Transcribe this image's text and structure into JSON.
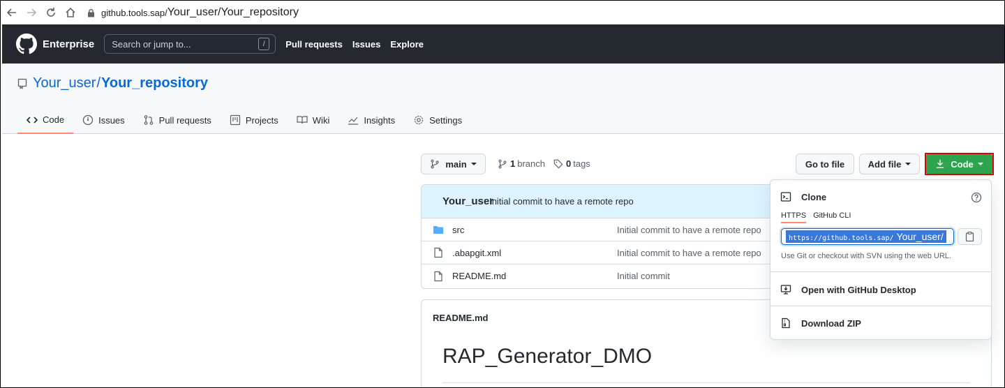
{
  "browser": {
    "url_host": "github.tools.sap/",
    "url_path": "Your_user/Your_repository"
  },
  "header": {
    "brand": "Enterprise",
    "search_placeholder": "Search or jump to...",
    "search_shortcut": "/",
    "nav": [
      "Pull requests",
      "Issues",
      "Explore"
    ]
  },
  "repo": {
    "owner": "Your_user",
    "separator": "/",
    "name": "Your_repository",
    "tabs": [
      "Code",
      "Issues",
      "Pull requests",
      "Projects",
      "Wiki",
      "Insights",
      "Settings"
    ]
  },
  "toolbar": {
    "branch_button": "main",
    "branch_count": "1",
    "branch_label": "branch",
    "tag_count": "0",
    "tag_label": "tags",
    "go_to_file": "Go to file",
    "add_file": "Add file",
    "code": "Code"
  },
  "commit": {
    "user": "Your_user",
    "message": "Initial commit to have a remote repo"
  },
  "files": [
    {
      "name": "src",
      "message": "Initial commit to have a remote repo",
      "type": "folder"
    },
    {
      "name": ".abapgit.xml",
      "message": "Initial commit to have a remote repo",
      "type": "file"
    },
    {
      "name": "README.md",
      "message": "Initial commit",
      "type": "file"
    }
  ],
  "readme": {
    "header": "README.md",
    "title": "RAP_Generator_DMO"
  },
  "clone": {
    "title": "Clone",
    "tab_https": "HTTPS",
    "tab_cli": "GitHub CLI",
    "url_prefix": "https://github.tools.sap/",
    "url_user": "Your_user/",
    "hint": "Use Git or checkout with SVN using the web URL.",
    "open_desktop": "Open with GitHub Desktop",
    "download_zip": "Download ZIP"
  },
  "colors": {
    "header_bg": "#24292f",
    "code_button": "#2da44e",
    "highlight_border": "#e00000",
    "link": "#0969da",
    "active_tab": "#fd8c73"
  }
}
